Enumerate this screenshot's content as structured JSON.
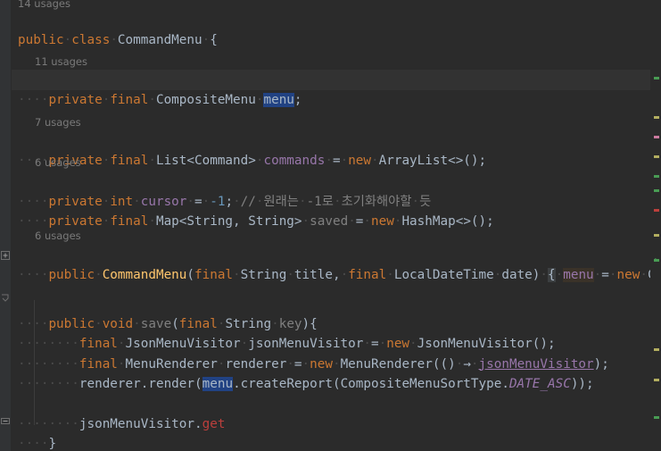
{
  "app": {
    "name": "IntelliJ IDEA Editor",
    "file_name": "CommandMenu.java",
    "language": "Java",
    "theme": "Darcula",
    "background": "#2b2b2b",
    "gutter_background": "#313335",
    "current_line_background": "#323232",
    "selection_color": "#214283"
  },
  "palette": {
    "keyword": "#cc7832",
    "identifier": "#a9b7c6",
    "field": "#9876aa",
    "method_declaration": "#ffc66d",
    "number": "#6897bb",
    "comment": "#808080",
    "error": "#bc3f3c",
    "greyed": "#808080",
    "selection": "#214283",
    "soft_highlight": "#3a3228",
    "fold_highlight": "#3c3f41"
  },
  "editor": {
    "usage_hints": [
      {
        "text": "14 usages",
        "line": 0
      },
      {
        "text": "11 usages",
        "line": 3
      },
      {
        "text": "7 usages",
        "line": 6
      },
      {
        "text": "6 usages",
        "line": 8
      },
      {
        "text": "6 usages",
        "line": 11
      }
    ],
    "code_lines": [
      {
        "index": 0,
        "indent": 0,
        "raw": "public class CommandMenu {",
        "tokens": [
          {
            "t": "public",
            "c": "kw"
          },
          {
            "t": " ",
            "c": "ws-dot"
          },
          {
            "t": "class",
            "c": "kw"
          },
          {
            "t": " ",
            "c": "ws-dot"
          },
          {
            "t": "CommandMenu",
            "c": "type"
          },
          {
            "t": " ",
            "c": "ws-dot"
          },
          {
            "t": "{",
            "c": "op"
          }
        ]
      },
      {
        "index": 1,
        "indent": 1,
        "raw": "private final CompositeMenu menu;",
        "current_line": true,
        "tokens": [
          {
            "t": "private",
            "c": "kw"
          },
          {
            "t": " ",
            "c": "ws-dot"
          },
          {
            "t": "final",
            "c": "kw"
          },
          {
            "t": " ",
            "c": "ws-dot"
          },
          {
            "t": "CompositeMenu",
            "c": "type"
          },
          {
            "t": " ",
            "c": "ws-dot"
          },
          {
            "t": "menu",
            "c": "sel"
          },
          {
            "t": ";",
            "c": "op"
          }
        ]
      },
      {
        "index": 2,
        "indent": 1,
        "raw": "private final List<Command> commands = new ArrayList<>();",
        "tokens": [
          {
            "t": "private",
            "c": "kw"
          },
          {
            "t": " ",
            "c": "ws-dot"
          },
          {
            "t": "final",
            "c": "kw"
          },
          {
            "t": " ",
            "c": "ws-dot"
          },
          {
            "t": "List<Command>",
            "c": "type"
          },
          {
            "t": " ",
            "c": "ws-dot"
          },
          {
            "t": "commands",
            "c": "field"
          },
          {
            "t": " ",
            "c": "ws-dot"
          },
          {
            "t": "=",
            "c": "op"
          },
          {
            "t": " ",
            "c": "ws-dot"
          },
          {
            "t": "new",
            "c": "kw"
          },
          {
            "t": " ",
            "c": "ws-dot"
          },
          {
            "t": "ArrayList<>();",
            "c": "type"
          }
        ]
      },
      {
        "index": 3,
        "indent": 1,
        "raw": "private int cursor = -1; // 원래는 -1로 초기화해야할 듯",
        "tokens": [
          {
            "t": "private",
            "c": "kw"
          },
          {
            "t": " ",
            "c": "ws-dot"
          },
          {
            "t": "int",
            "c": "kw"
          },
          {
            "t": " ",
            "c": "ws-dot"
          },
          {
            "t": "cursor",
            "c": "field"
          },
          {
            "t": " ",
            "c": "ws-dot"
          },
          {
            "t": "=",
            "c": "op"
          },
          {
            "t": " ",
            "c": "ws-dot"
          },
          {
            "t": "-1",
            "c": "num"
          },
          {
            "t": ";",
            "c": "op"
          },
          {
            "t": " ",
            "c": "ws-dot"
          },
          {
            "t": "// 원래는 -1로 초기화해야할 듯",
            "c": "cmt"
          }
        ]
      },
      {
        "index": 4,
        "indent": 1,
        "raw": "private final Map<String, String> saved = new HashMap<>();",
        "tokens": [
          {
            "t": "private",
            "c": "kw"
          },
          {
            "t": " ",
            "c": "ws-dot"
          },
          {
            "t": "final",
            "c": "kw"
          },
          {
            "t": " ",
            "c": "ws-dot"
          },
          {
            "t": "Map<String, String>",
            "c": "type"
          },
          {
            "t": " ",
            "c": "ws-dot"
          },
          {
            "t": "saved",
            "c": "greyed"
          },
          {
            "t": " ",
            "c": "ws-dot"
          },
          {
            "t": "=",
            "c": "op"
          },
          {
            "t": " ",
            "c": "ws-dot"
          },
          {
            "t": "new",
            "c": "kw"
          },
          {
            "t": " ",
            "c": "ws-dot"
          },
          {
            "t": "HashMap<>();",
            "c": "type"
          }
        ]
      },
      {
        "index": 5,
        "indent": 1,
        "raw": "public CommandMenu(final String title, final LocalDateTime date) { menu = new CompositeM",
        "truncated_right": true,
        "tokens": [
          {
            "t": "public",
            "c": "kw"
          },
          {
            "t": " ",
            "c": "ws-dot"
          },
          {
            "t": "CommandMenu",
            "c": "mth"
          },
          {
            "t": "(",
            "c": "op"
          },
          {
            "t": "final",
            "c": "kw"
          },
          {
            "t": " ",
            "c": "ws-dot"
          },
          {
            "t": "String",
            "c": "type"
          },
          {
            "t": " ",
            "c": "ws-dot"
          },
          {
            "t": "title",
            "c": "param"
          },
          {
            "t": ", ",
            "c": "op"
          },
          {
            "t": "final",
            "c": "kw"
          },
          {
            "t": " ",
            "c": "ws-dot"
          },
          {
            "t": "LocalDateTime",
            "c": "type"
          },
          {
            "t": " ",
            "c": "ws-dot"
          },
          {
            "t": "date",
            "c": "param"
          },
          {
            "t": ")",
            "c": "op"
          },
          {
            "t": " ",
            "c": "ws-dot"
          },
          {
            "t": "{",
            "c": "foldhl"
          },
          {
            "t": " ",
            "c": "ws-dot"
          },
          {
            "t": "menu",
            "c": "softhl-field"
          },
          {
            "t": " ",
            "c": "ws-dot"
          },
          {
            "t": "=",
            "c": "op"
          },
          {
            "t": " ",
            "c": "ws-dot"
          },
          {
            "t": "new",
            "c": "kw"
          },
          {
            "t": " ",
            "c": "ws-dot"
          },
          {
            "t": "CompositeM",
            "c": "type"
          }
        ]
      },
      {
        "index": 6,
        "indent": 1,
        "raw": "public void save(final String key){",
        "tokens": [
          {
            "t": "public",
            "c": "kw"
          },
          {
            "t": " ",
            "c": "ws-dot"
          },
          {
            "t": "void",
            "c": "kw"
          },
          {
            "t": " ",
            "c": "ws-dot"
          },
          {
            "t": "save",
            "c": "greyed"
          },
          {
            "t": "(",
            "c": "op"
          },
          {
            "t": "final",
            "c": "kw"
          },
          {
            "t": " ",
            "c": "ws-dot"
          },
          {
            "t": "String",
            "c": "type"
          },
          {
            "t": " ",
            "c": "ws-dot"
          },
          {
            "t": "key",
            "c": "greyed"
          },
          {
            "t": "){",
            "c": "op"
          }
        ]
      },
      {
        "index": 7,
        "indent": 2,
        "raw": "final JsonMenuVisitor jsonMenuVisitor = new JsonMenuVisitor();",
        "tokens": [
          {
            "t": "final",
            "c": "kw"
          },
          {
            "t": " ",
            "c": "ws-dot"
          },
          {
            "t": "JsonMenuVisitor",
            "c": "type"
          },
          {
            "t": " ",
            "c": "ws-dot"
          },
          {
            "t": "jsonMenuVisitor",
            "c": "type"
          },
          {
            "t": " ",
            "c": "ws-dot"
          },
          {
            "t": "=",
            "c": "op"
          },
          {
            "t": " ",
            "c": "ws-dot"
          },
          {
            "t": "new",
            "c": "kw"
          },
          {
            "t": " ",
            "c": "ws-dot"
          },
          {
            "t": "JsonMenuVisitor();",
            "c": "type"
          }
        ]
      },
      {
        "index": 8,
        "indent": 2,
        "raw": "final MenuRenderer renderer = new MenuRenderer(() -> jsonMenuVisitor);",
        "tokens": [
          {
            "t": "final",
            "c": "kw"
          },
          {
            "t": " ",
            "c": "ws-dot"
          },
          {
            "t": "MenuRenderer",
            "c": "type"
          },
          {
            "t": " ",
            "c": "ws-dot"
          },
          {
            "t": "renderer",
            "c": "type"
          },
          {
            "t": " ",
            "c": "ws-dot"
          },
          {
            "t": "=",
            "c": "op"
          },
          {
            "t": " ",
            "c": "ws-dot"
          },
          {
            "t": "new",
            "c": "kw"
          },
          {
            "t": " ",
            "c": "ws-dot"
          },
          {
            "t": "MenuRenderer(() ",
            "c": "type"
          },
          {
            "t": "→",
            "c": "op"
          },
          {
            "t": " ",
            "c": "ws-dot"
          },
          {
            "t": "jsonMenuVisitor",
            "c": "field-ul"
          },
          {
            "t": ");",
            "c": "op"
          }
        ]
      },
      {
        "index": 9,
        "indent": 2,
        "raw": "renderer.render(menu.createReport(CompositeMenuSortType.DATE_ASC));",
        "tokens": [
          {
            "t": "renderer.render(",
            "c": "type"
          },
          {
            "t": "menu",
            "c": "sel"
          },
          {
            "t": ".createReport(CompositeMenuSortType.",
            "c": "type"
          },
          {
            "t": "DATE_ASC",
            "c": "static-f"
          },
          {
            "t": "));",
            "c": "op"
          }
        ]
      },
      {
        "index": 10,
        "indent": 2,
        "raw": "jsonMenuVisitor.get",
        "tokens": [
          {
            "t": "jsonMenuVisitor.",
            "c": "type"
          },
          {
            "t": "get",
            "c": "err"
          }
        ]
      },
      {
        "index": 11,
        "indent": 1,
        "raw": "}",
        "tokens": [
          {
            "t": "}",
            "c": "op"
          }
        ]
      }
    ],
    "fold_markers": [
      {
        "glyph": "+",
        "name": "fold-expand-marker"
      },
      {
        "glyph": "v",
        "name": "fold-collapse-marker"
      },
      {
        "glyph": "-",
        "name": "fold-end-marker"
      }
    ],
    "stripe_markers": [
      {
        "color": "#499c54",
        "label": "vcs-added"
      },
      {
        "color": "#b3ae60",
        "label": "warning"
      },
      {
        "color": "#cc7aa0",
        "label": "typo"
      },
      {
        "color": "#bc3f3c",
        "label": "error"
      }
    ]
  }
}
